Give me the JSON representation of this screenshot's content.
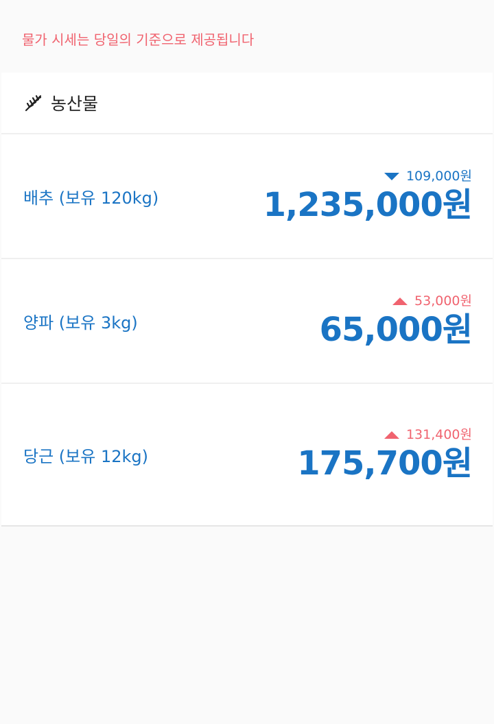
{
  "notice": "물가 시세는 당일의 기준으로 제공됩니다",
  "section": {
    "icon": "wheat-icon",
    "title": "농산물"
  },
  "items": [
    {
      "name": "배추 (보유 120kg)",
      "direction": "down",
      "change": "109,000원",
      "price": "1,235,000원"
    },
    {
      "name": "양파 (보유 3kg)",
      "direction": "up",
      "change": "53,000원",
      "price": "65,000원"
    },
    {
      "name": "당근 (보유 12kg)",
      "direction": "up",
      "change": "131,400원",
      "price": "175,700원"
    }
  ],
  "colors": {
    "accent_blue": "#1a74c4",
    "accent_red": "#f0636f",
    "background": "#fafafa"
  }
}
